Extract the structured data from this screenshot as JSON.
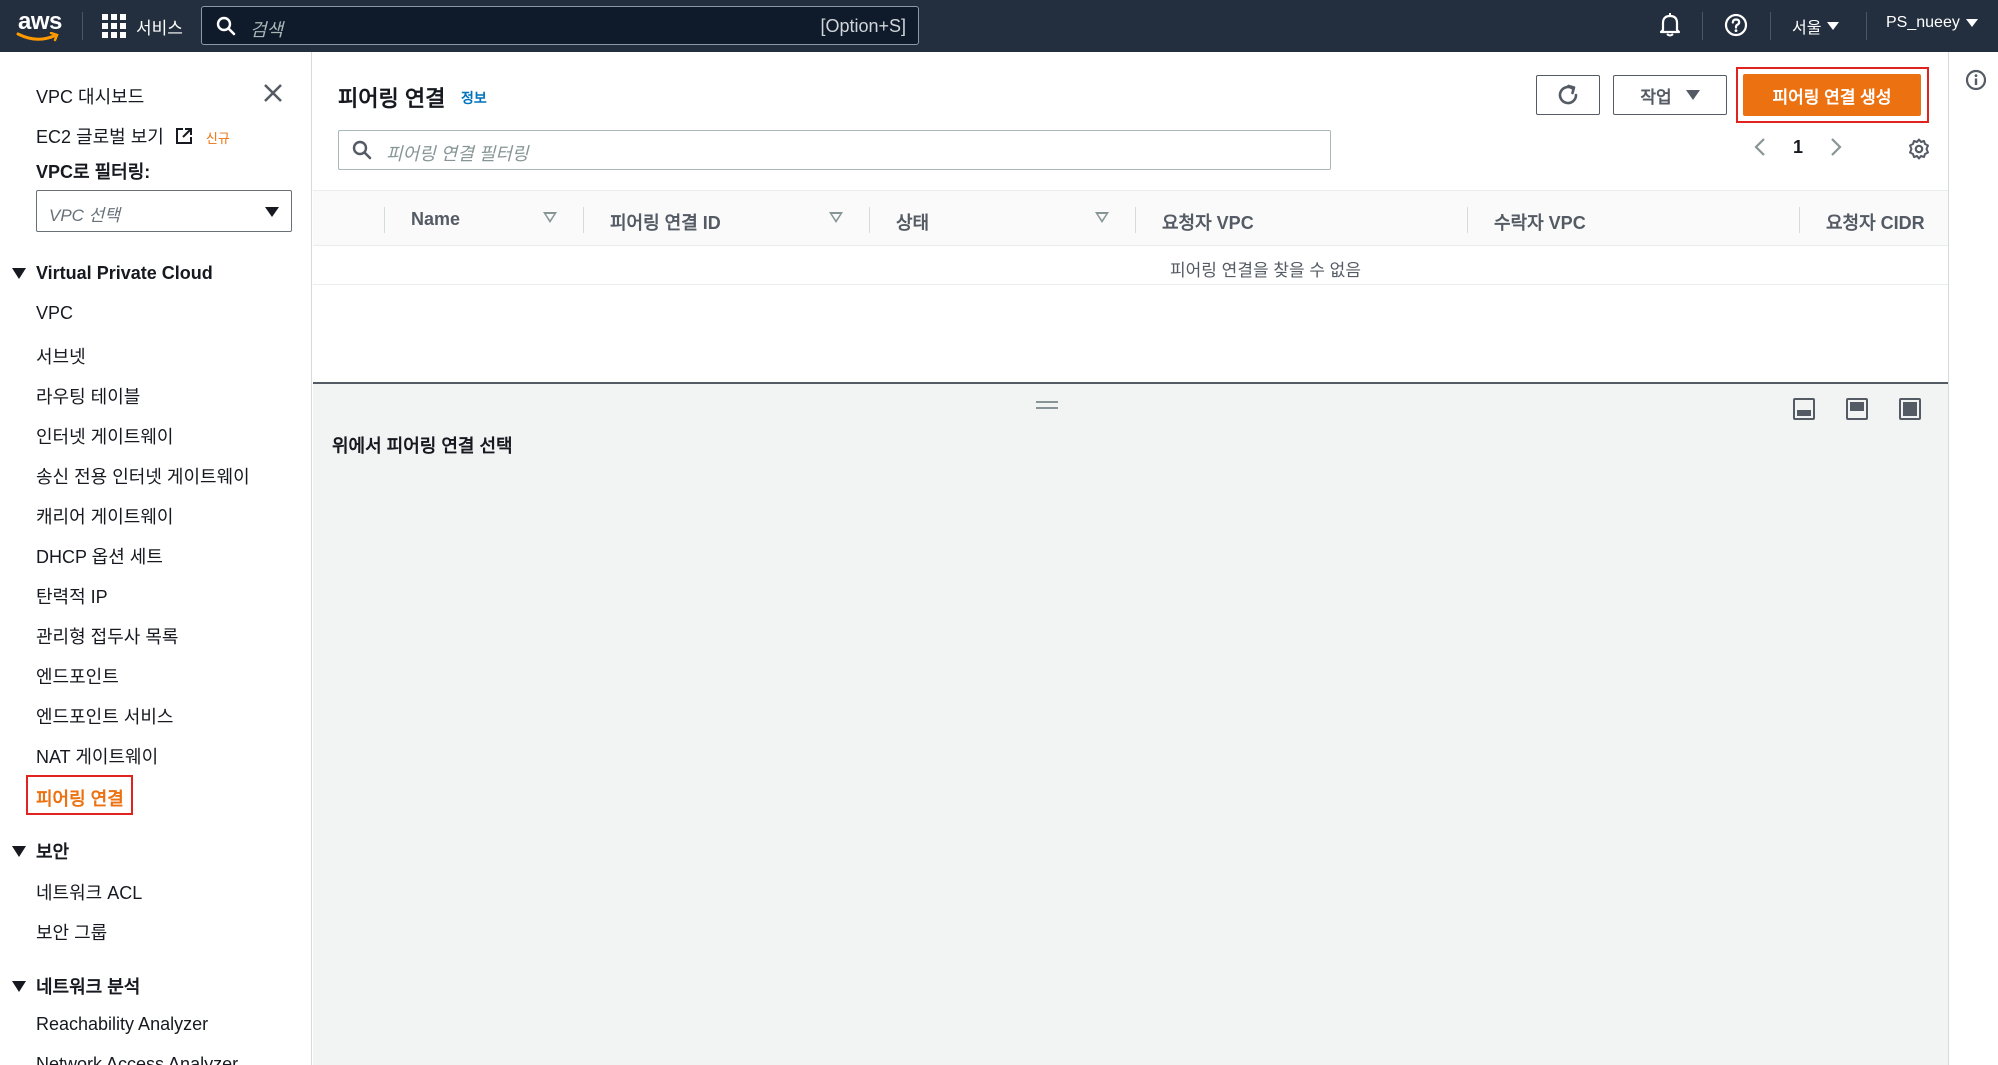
{
  "topnav": {
    "logo_text": "aws",
    "services_label": "서비스",
    "search_placeholder": "검색",
    "search_shortcut": "[Option+S]",
    "region": "서울",
    "user": "PS_nueey"
  },
  "sidebar": {
    "dashboard": "VPC 대시보드",
    "ec2_global": "EC2 글로벌 보기",
    "new_badge": "신규",
    "filter_label": "VPC로 필터링:",
    "filter_placeholder": "VPC 선택",
    "sections": [
      {
        "title": "Virtual Private Cloud",
        "items": [
          "VPC",
          "서브넷",
          "라우팅 테이블",
          "인터넷 게이트웨이",
          "송신 전용 인터넷 게이트웨이",
          "캐리어 게이트웨이",
          "DHCP 옵션 세트",
          "탄력적 IP",
          "관리형 접두사 목록",
          "엔드포인트",
          "엔드포인트 서비스",
          "NAT 게이트웨이",
          "피어링 연결"
        ]
      },
      {
        "title": "보안",
        "items": [
          "네트워크 ACL",
          "보안 그룹"
        ]
      },
      {
        "title": "네트워크 분석",
        "items": [
          "Reachability Analyzer",
          "Network Access Analyzer"
        ]
      }
    ],
    "active_item": "피어링 연결"
  },
  "main": {
    "title": "피어링 연결",
    "info_link": "정보",
    "action_button": "작업",
    "create_button": "피어링 연결 생성",
    "filter_placeholder": "피어링 연결 필터링",
    "page_number": "1",
    "columns": [
      "Name",
      "피어링 연결 ID",
      "상태",
      "요청자 VPC",
      "수락자 VPC",
      "요청자 CIDR"
    ],
    "empty_message": "피어링 연결을 찾을 수 없음",
    "detail_message": "위에서 피어링 연결 선택"
  },
  "colors": {
    "nav_bg": "#232f3e",
    "accent": "#ec7211",
    "highlight_border": "#e0231e",
    "link": "#0073bb"
  }
}
